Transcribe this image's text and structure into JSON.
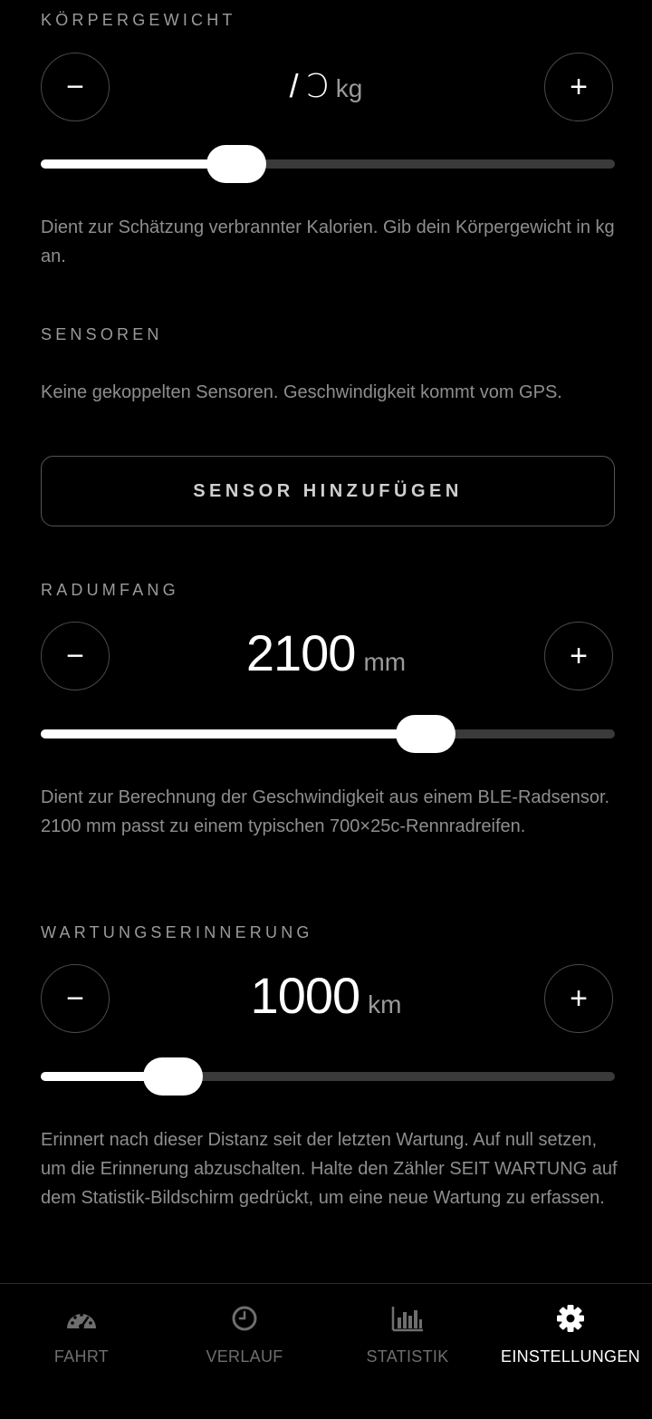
{
  "settings": {
    "weight": {
      "label": "KÖRPERGEWICHT",
      "value": "/ Ↄ",
      "unit": "kg",
      "slider_level": 0.34,
      "description": "Dient zur Schätzung verbrannter Kalorien. Gib dein Körpergewicht in kg an.",
      "decrement_symbol": "−",
      "increment_symbol": "+"
    },
    "sensors": {
      "label": "SENSOREN",
      "description": "Keine gekoppelten Sensoren. Geschwindigkeit kommt vom GPS.",
      "add_button_label": "SENSOR HINZUFÜGEN"
    },
    "wheel": {
      "label": "RADUMFANG",
      "value": "2100",
      "unit": "mm",
      "slider_level": 0.67,
      "description": "Dient zur Berechnung der Geschwindigkeit aus einem BLE-Radsensor. 2100 mm passt zu einem typischen 700×25c-Rennradreifen.",
      "decrement_symbol": "−",
      "increment_symbol": "+"
    },
    "maintenance": {
      "label": "WARTUNGSERINNERUNG",
      "value": "1000",
      "unit": "km",
      "slider_level": 0.23,
      "description": "Erinnert nach dieser Distanz seit der letzten Wartung. Auf null setzen, um die Erinnerung abzuschalten. Halte den Zähler SEIT WARTUNG auf dem Statistik-Bildschirm gedrückt, um eine neue Wartung zu erfassen.",
      "decrement_symbol": "−",
      "increment_symbol": "+"
    }
  },
  "tabbar": {
    "tabs": [
      {
        "label": "FAHRT",
        "icon": "speedometer-icon",
        "active": false
      },
      {
        "label": "VERLAUF",
        "icon": "clock-icon",
        "active": false
      },
      {
        "label": "STATISTIK",
        "icon": "bar-chart-icon",
        "active": false
      },
      {
        "label": "EINSTELLUNGEN",
        "icon": "gear-icon",
        "active": true
      }
    ]
  },
  "colors": {
    "background": "#000000",
    "text_primary": "#ffffff",
    "text_secondary": "#8e8e8e",
    "track": "#3a3a3a",
    "tab_inactive": "#6e6e6e"
  }
}
